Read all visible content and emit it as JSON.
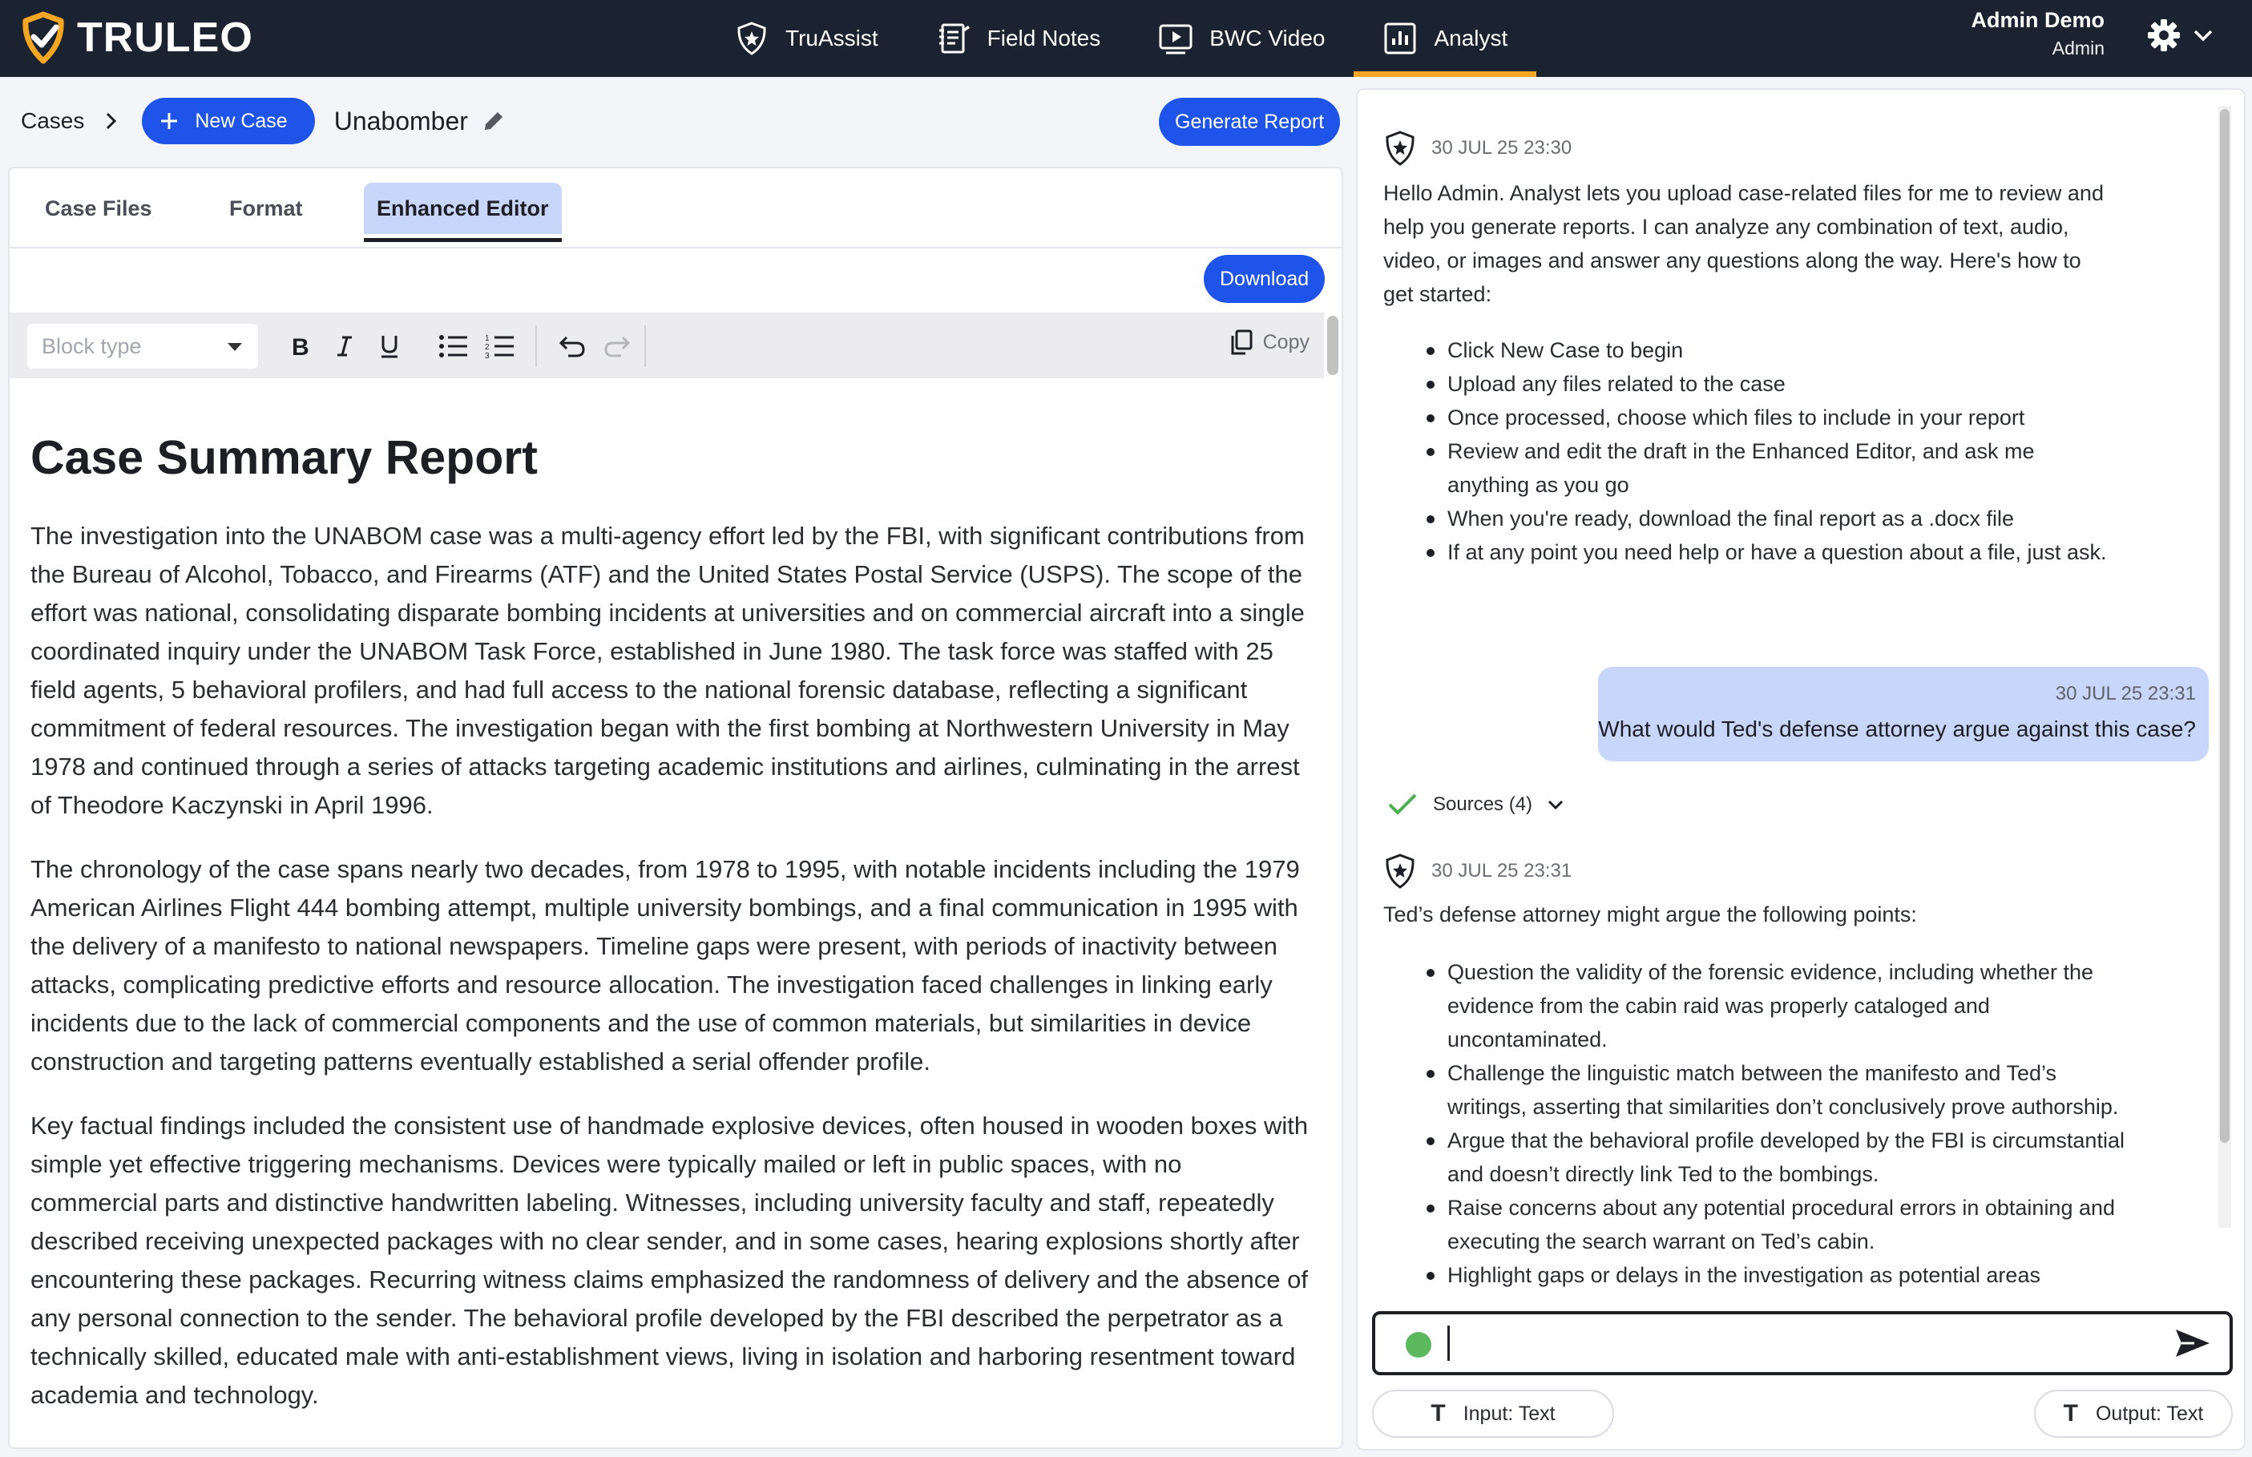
{
  "app": {
    "name": "TRULEO"
  },
  "nav": [
    {
      "label": "TruAssist",
      "icon": "shield-star-icon"
    },
    {
      "label": "Field Notes",
      "icon": "notebook-icon"
    },
    {
      "label": "BWC Video",
      "icon": "video-player-icon"
    },
    {
      "label": "Analyst",
      "icon": "bar-chart-icon",
      "active": true
    }
  ],
  "user": {
    "name": "Admin Demo",
    "role": "Admin"
  },
  "colors": {
    "topbar": "#1c2330",
    "accent": "#f5a623",
    "primary": "#1f54ea",
    "tab_active": "#c9d6fb"
  },
  "breadcrumb": {
    "root": "Cases",
    "new_case_label": "New Case",
    "case_name": "Unabomber",
    "generate_report_label": "Generate Report"
  },
  "tabs": [
    {
      "label": "Case Files"
    },
    {
      "label": "Format"
    },
    {
      "label": "Enhanced Editor",
      "active": true
    }
  ],
  "editor": {
    "download_label": "Download",
    "block_type_placeholder": "Block type",
    "copy_label": "Copy",
    "title": "Case Summary Report",
    "paragraphs": [
      "The investigation into the UNABOM case was a multi-agency effort led by the FBI, with significant contributions from the Bureau of Alcohol, Tobacco, and Firearms (ATF) and the United States Postal Service (USPS). The scope of the effort was national, consolidating disparate bombing incidents at universities and on commercial aircraft into a single coordinated inquiry under the UNABOM Task Force, established in June 1980. The task force was staffed with 25 field agents, 5 behavioral profilers, and had full access to the national forensic database, reflecting a significant commitment of federal resources. The investigation began with the first bombing at Northwestern University in May 1978 and continued through a series of attacks targeting academic institutions and airlines, culminating in the arrest of Theodore Kaczynski in April 1996.",
      "The chronology of the case spans nearly two decades, from 1978 to 1995, with notable incidents including the 1979 American Airlines Flight 444 bombing attempt, multiple university bombings, and a final communication in 1995 with the delivery of a manifesto to national newspapers. Timeline gaps were present, with periods of inactivity between attacks, complicating predictive efforts and resource allocation. The investigation faced challenges in linking early incidents due to the lack of commercial components and the use of common materials, but similarities in device construction and targeting patterns eventually established a serial offender profile.",
      "Key factual findings included the consistent use of handmade explosive devices, often housed in wooden boxes with simple yet effective triggering mechanisms. Devices were typically mailed or left in public spaces, with no commercial parts and distinctive handwritten labeling. Witnesses, including university faculty and staff, repeatedly described receiving unexpected packages with no clear sender, and in some cases, hearing explosions shortly after encountering these packages. Recurring witness claims emphasized the randomness of delivery and the absence of any personal connection to the sender. The behavioral profile developed by the FBI described the perpetrator as a technically skilled, educated male with anti-establishment views, living in isolation and harboring resentment toward academia and technology."
    ]
  },
  "chat": {
    "msg1": {
      "timestamp": "30 JUL 25 23:30",
      "intro": "Hello Admin. Analyst lets you upload case-related files for me to review and help you generate reports. I can analyze any combination of text, audio, video, or images and answer any questions along the way. Here's how to get started:",
      "items": [
        "Click New Case to begin",
        "Upload any files related to the case",
        "Once processed, choose which files to include in your report",
        "Review and edit the draft in the Enhanced Editor, and ask me anything as you go",
        "When you're ready, download the final report as a .docx file",
        "If at any point you need help or have a question about a file, just ask."
      ]
    },
    "user_msg": {
      "timestamp": "30 JUL 25 23:31",
      "text": "What would Ted's defense attorney argue against this case?"
    },
    "sources_label": "Sources (4)",
    "msg2": {
      "timestamp": "30 JUL 25 23:31",
      "intro": "Ted’s defense attorney might argue the following points:",
      "items": [
        "Question the validity of the forensic evidence, including whether the evidence from the cabin raid was properly cataloged and uncontaminated.",
        "Challenge the linguistic match between the manifesto and Ted’s writings, asserting that similarities don’t conclusively prove authorship.",
        "Argue that the behavioral profile developed by the FBI is circumstantial and doesn’t directly link Ted to the bombings.",
        "Raise concerns about any potential procedural errors in obtaining and executing the search warrant on Ted’s cabin.",
        "Highlight gaps or delays in the investigation as potential areas"
      ]
    },
    "input_mode_label": "Input: Text",
    "output_mode_label": "Output: Text"
  }
}
